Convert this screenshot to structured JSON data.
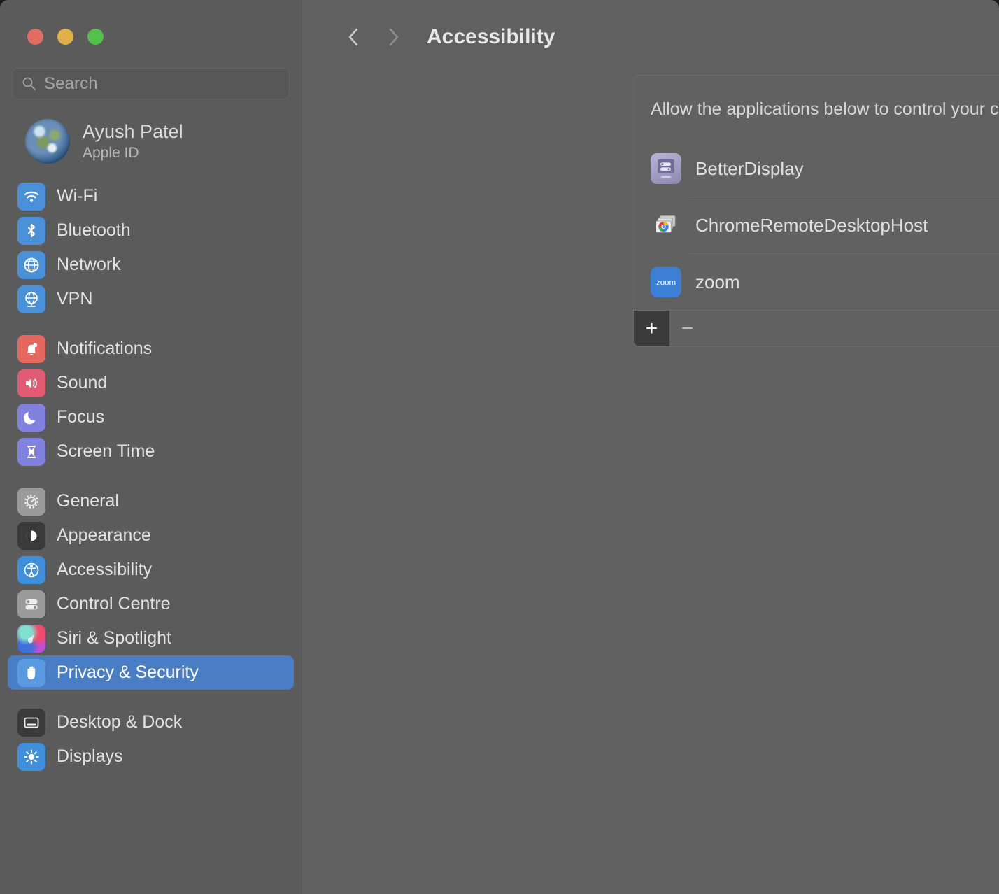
{
  "window": {
    "traffic_lights": [
      {
        "name": "close",
        "color": "#e06c63"
      },
      {
        "name": "minimize",
        "color": "#e0b04a"
      },
      {
        "name": "zoom",
        "color": "#52c04a"
      }
    ]
  },
  "sidebar": {
    "search": {
      "placeholder": "Search",
      "value": "",
      "icon": "search-icon"
    },
    "account": {
      "name": "Ayush Patel",
      "subtitle": "Apple ID",
      "avatar": "earth-avatar"
    },
    "groups": [
      {
        "items": [
          {
            "label": "Wi-Fi",
            "icon": "wifi-icon",
            "selected": false
          },
          {
            "label": "Bluetooth",
            "icon": "bluetooth-icon",
            "selected": false
          },
          {
            "label": "Network",
            "icon": "globe-icon",
            "selected": false
          },
          {
            "label": "VPN",
            "icon": "vpn-globe-icon",
            "selected": false
          }
        ]
      },
      {
        "items": [
          {
            "label": "Notifications",
            "icon": "bell-icon",
            "selected": false
          },
          {
            "label": "Sound",
            "icon": "speaker-icon",
            "selected": false
          },
          {
            "label": "Focus",
            "icon": "moon-icon",
            "selected": false
          },
          {
            "label": "Screen Time",
            "icon": "hourglass-icon",
            "selected": false
          }
        ]
      },
      {
        "items": [
          {
            "label": "General",
            "icon": "gear-icon",
            "selected": false
          },
          {
            "label": "Appearance",
            "icon": "appearance-icon",
            "selected": false
          },
          {
            "label": "Accessibility",
            "icon": "accessibility-icon",
            "selected": false
          },
          {
            "label": "Control Centre",
            "icon": "control-centre-icon",
            "selected": false
          },
          {
            "label": "Siri & Spotlight",
            "icon": "siri-icon",
            "selected": false
          },
          {
            "label": "Privacy & Security",
            "icon": "hand-icon",
            "selected": true
          }
        ]
      },
      {
        "items": [
          {
            "label": "Desktop & Dock",
            "icon": "desktop-dock-icon",
            "selected": false
          },
          {
            "label": "Displays",
            "icon": "brightness-icon",
            "selected": false
          }
        ]
      }
    ]
  },
  "content": {
    "back_icon": "chevron-left-icon",
    "forward_icon": "chevron-right-icon",
    "title": "Accessibility",
    "panel": {
      "description": "Allow the applications below to control your computer.",
      "apps": [
        {
          "name": "BetterDisplay",
          "icon": "betterdisplay-icon",
          "enabled": true
        },
        {
          "name": "ChromeRemoteDesktopHost",
          "icon": "chrome-remote-desktop-icon",
          "enabled": true
        },
        {
          "name": "zoom",
          "icon": "zoom-app-icon",
          "enabled": true
        }
      ],
      "footer": {
        "add_label": "+",
        "remove_label": "−",
        "add_active": true
      }
    }
  },
  "colors": {
    "accent": "#4a7ec4",
    "toggle_on": "#4a7dc0",
    "sidebar_bg": "#5b5b5b",
    "content_bg": "#606060",
    "panel_bg": "#616161"
  }
}
